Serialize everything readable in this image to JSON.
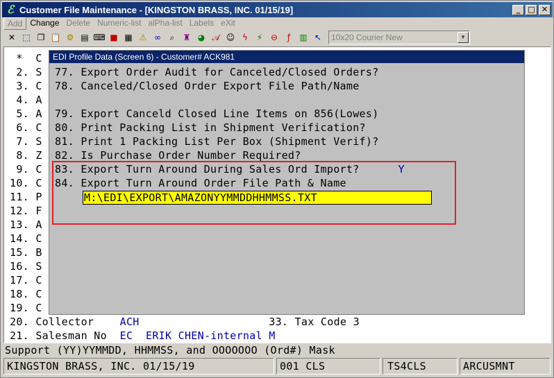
{
  "window": {
    "title": "Customer File Maintenance - [KINGSTON BRASS, INC. 01/15/19]"
  },
  "menu": [
    "Add",
    "Change",
    "Delete",
    "Numeric-list",
    "alPha-list",
    "Labels",
    "eXit"
  ],
  "toolbar_icons": [
    "close-x-icon",
    "select-icon",
    "copy-icon",
    "paste-icon",
    "settings-icon",
    "report-icon",
    "keyboard-icon",
    "stop-icon",
    "form-icon",
    "alert-icon",
    "binoculars-icon",
    "magnify-icon",
    "stamp-icon",
    "color-icon",
    "font-a-icon",
    "person-icon",
    "lightning-icon",
    "macro-icon",
    "link-icon",
    "function-icon",
    "list-icon",
    "help-pointer-icon"
  ],
  "font_select": {
    "value": "10x20 Courier New"
  },
  "background_lines": [
    {
      "num": " *",
      "text": "C"
    },
    {
      "num": " 2.",
      "text": "S"
    },
    {
      "num": " 3.",
      "text": "C"
    },
    {
      "num": " 4.",
      "text": "A"
    },
    {
      "num": " 5.",
      "text": "A"
    },
    {
      "num": " 6.",
      "text": "C"
    },
    {
      "num": " 7.",
      "text": "S"
    },
    {
      "num": " 8.",
      "text": "Z"
    },
    {
      "num": " 9.",
      "text": "C"
    },
    {
      "num": "10.",
      "text": "C"
    },
    {
      "num": "11.",
      "text": "P"
    },
    {
      "num": "12.",
      "text": "F"
    },
    {
      "num": "13.",
      "text": "A"
    },
    {
      "num": "14.",
      "text": "C"
    },
    {
      "num": "15.",
      "text": "B"
    },
    {
      "num": "16.",
      "text": "S"
    },
    {
      "num": "17.",
      "text": "C"
    },
    {
      "num": "18.",
      "text": "C"
    },
    {
      "num": "19.",
      "text": "C"
    }
  ],
  "row20": {
    "label": "20. Collector",
    "value": "ACH",
    "right_label": "33. Tax Code",
    "right_value": "3"
  },
  "row21": {
    "label": "21. Salesman No",
    "code": "EC",
    "name": "ERIK CHEN-internal",
    "flag": "M"
  },
  "popup": {
    "title": "EDI Profile Data (Screen 6) - Customer# ACK981",
    "lines": [
      "77. Export Order Audit for Canceled/Closed Orders?",
      "78. Canceled/Closed Order Export File Path/Name",
      "",
      "79. Export Canceld Closed Line Items on 856(Lowes)",
      "80. Print Packing List in Shipment Verification?",
      "81. Print 1 Packing List Per Box (Shipment Verif)?",
      "82. Is Purchase Order Number Required?"
    ],
    "line83": {
      "text": "83. Export Turn Around During Sales Ord Import?",
      "value": "Y"
    },
    "line84": {
      "text": "84. Export Turn Around Order File Path & Name"
    },
    "path_value": "M:\\EDI\\EXPORT\\AMAZONYYMMDDHHMMSS.TXT"
  },
  "help_line": "Support (YY)YYMMDD, HHMMSS, and OOOOOOO (Ord#) Mask",
  "status": {
    "company": "KINGSTON BRASS, INC. 01/15/19",
    "code": "001 CLS",
    "terminal": "TS4CLS",
    "program": "ARCUSMNT"
  }
}
